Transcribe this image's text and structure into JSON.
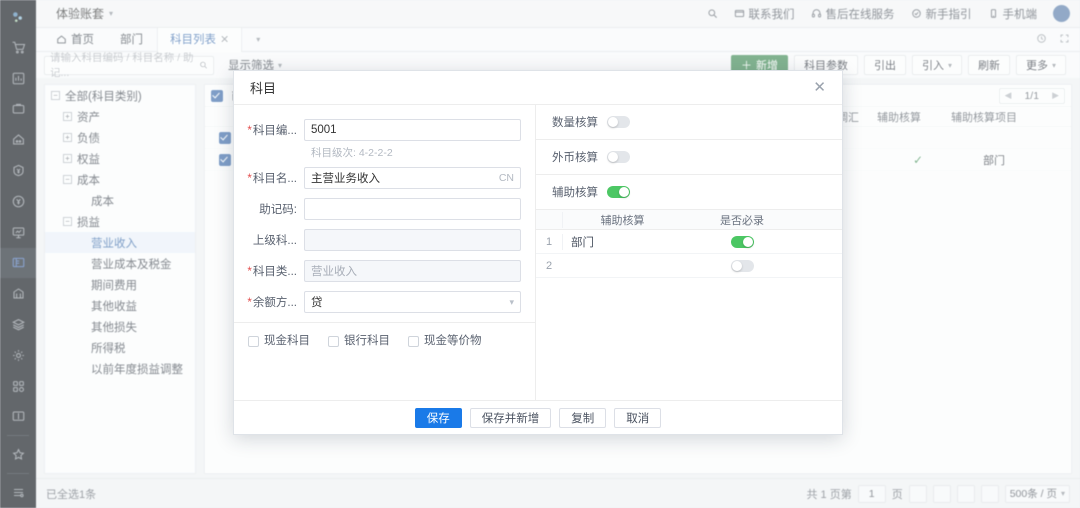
{
  "rail": {
    "logo": "app-logo",
    "items": [
      {
        "name": "cart-icon"
      },
      {
        "name": "chart-report-icon"
      },
      {
        "name": "briefcase-icon"
      },
      {
        "name": "home-icon"
      },
      {
        "name": "yen-badge-icon"
      },
      {
        "name": "yen-circle-icon"
      },
      {
        "name": "presentation-icon"
      },
      {
        "name": "ledger-icon",
        "active": true
      },
      {
        "name": "bank-icon"
      },
      {
        "name": "layers-icon"
      },
      {
        "name": "gear-icon"
      },
      {
        "name": "apps-grid-icon"
      },
      {
        "name": "book-icon"
      }
    ],
    "bottom": [
      {
        "name": "star-icon"
      },
      {
        "name": "settings-list-icon"
      }
    ]
  },
  "topbar": {
    "account": "体验账套",
    "links": [
      {
        "icon": "search-icon",
        "label": ""
      },
      {
        "icon": "contact-icon",
        "label": "联系我们"
      },
      {
        "icon": "headset-icon",
        "label": "售后在线服务"
      },
      {
        "icon": "guide-icon",
        "label": "新手指引"
      },
      {
        "icon": "mobile-icon",
        "label": "手机端"
      }
    ]
  },
  "tabs": {
    "items": [
      {
        "label": "首页",
        "icon": "home-icon",
        "active": false
      },
      {
        "label": "部门",
        "active": false
      },
      {
        "label": "科目列表",
        "active": true,
        "closable": true
      }
    ],
    "more_icon": "chevron-down-icon",
    "right_icons": [
      "history-icon",
      "fullscreen-icon"
    ]
  },
  "toolbar": {
    "search_placeholder": "请输入科目编码 / 科目名称 / 助记...",
    "search_icon": "search-icon",
    "filter_label": "显示筛选",
    "buttons": [
      {
        "label": "新增",
        "primary": true,
        "prefix": "+"
      },
      {
        "label": "科目参数"
      },
      {
        "label": "引出"
      },
      {
        "label": "引入",
        "caret": true
      },
      {
        "label": "刷新"
      },
      {
        "label": "更多",
        "caret": true
      }
    ]
  },
  "tree": {
    "nodes": [
      {
        "label": "全部(科目类别)",
        "indent": 0,
        "toggle": "−"
      },
      {
        "label": "资产",
        "indent": 1,
        "toggle": "+"
      },
      {
        "label": "负债",
        "indent": 1,
        "toggle": "+"
      },
      {
        "label": "权益",
        "indent": 1,
        "toggle": "+"
      },
      {
        "label": "成本",
        "indent": 1,
        "toggle": "−"
      },
      {
        "label": "成本",
        "indent": 2,
        "toggle": ""
      },
      {
        "label": "损益",
        "indent": 1,
        "toggle": "−"
      },
      {
        "label": "营业收入",
        "indent": 2,
        "toggle": "",
        "selected": true
      },
      {
        "label": "营业成本及税金",
        "indent": 2,
        "toggle": ""
      },
      {
        "label": "期间费用",
        "indent": 2,
        "toggle": ""
      },
      {
        "label": "其他收益",
        "indent": 2,
        "toggle": ""
      },
      {
        "label": "其他损失",
        "indent": 2,
        "toggle": ""
      },
      {
        "label": "所得税",
        "indent": 2,
        "toggle": ""
      },
      {
        "label": "以前年度损益调整",
        "indent": 2,
        "toggle": ""
      }
    ]
  },
  "list": {
    "select_all_label": "已全",
    "pager_mini": "1/1",
    "columns": [
      "期末调汇",
      "辅助核算",
      "辅助核算项目"
    ],
    "rows": [
      {
        "checked": true,
        "tick": "",
        "aux_item": ""
      },
      {
        "checked": true,
        "tick": "✓",
        "aux_item": "部门"
      }
    ]
  },
  "status": {
    "selection": "已全选1条",
    "total_prefix": "共 1 页第",
    "page_value": "1",
    "total_suffix": "页",
    "page_size": "500条 / 页"
  },
  "modal": {
    "title": "科目",
    "close_icon": "close-icon",
    "fields": [
      {
        "key": "code",
        "label": "科目编...",
        "required": true,
        "value": "5001",
        "readonly": false,
        "suffix": ""
      },
      {
        "key": "name",
        "label": "科目名...",
        "required": true,
        "value": "主营业务收入",
        "readonly": false,
        "suffix": "CN"
      },
      {
        "key": "mnemonic",
        "label": "助记码:",
        "required": false,
        "value": "",
        "readonly": false,
        "suffix": ""
      },
      {
        "key": "parent",
        "label": "上级科...",
        "required": false,
        "value": "",
        "readonly": true,
        "suffix": ""
      },
      {
        "key": "category",
        "label": "科目类...",
        "required": true,
        "value": "营业收入",
        "readonly": true,
        "suffix": ""
      },
      {
        "key": "balance_dir",
        "label": "余额方...",
        "required": true,
        "value": "贷",
        "readonly": false,
        "suffix": "",
        "select": true
      }
    ],
    "level_hint": "科目级次: 4-2-2-2",
    "checkboxes": [
      {
        "label": "现金科目",
        "checked": false
      },
      {
        "label": "银行科目",
        "checked": false
      },
      {
        "label": "现金等价物",
        "checked": false
      }
    ],
    "switches": [
      {
        "label": "数量核算",
        "on": false
      },
      {
        "label": "外币核算",
        "on": false
      },
      {
        "label": "辅助核算",
        "on": true
      }
    ],
    "aux_table": {
      "columns": [
        "辅助核算",
        "是否必录"
      ],
      "rows": [
        {
          "index": "1",
          "name": "部门",
          "required_on": true
        },
        {
          "index": "2",
          "name": "",
          "required_on": false
        }
      ]
    },
    "footer_buttons": [
      {
        "label": "保存",
        "primary": true
      },
      {
        "label": "保存并新增"
      },
      {
        "label": "复制"
      },
      {
        "label": "取消"
      }
    ]
  },
  "colors": {
    "primary": "#1a7ae8",
    "success": "#34a853",
    "toggle_on": "#4cc764",
    "link": "#3a82e4"
  }
}
